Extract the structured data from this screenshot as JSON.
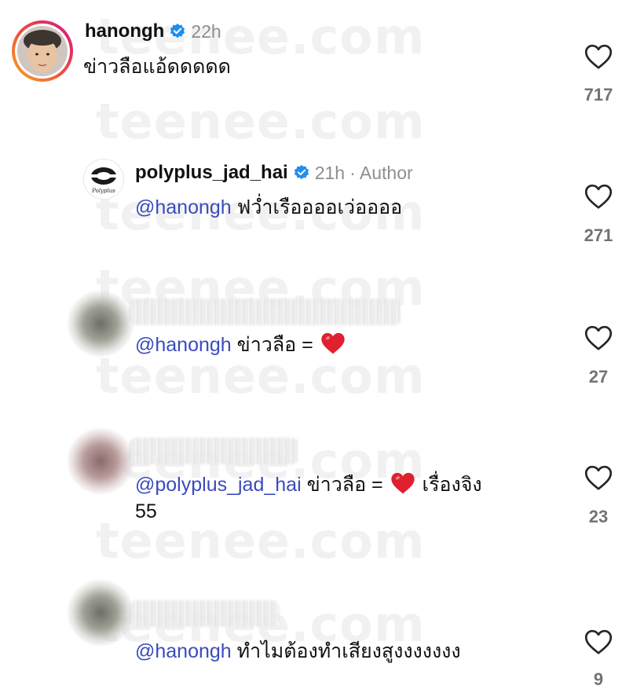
{
  "watermark": "teenee.com",
  "comments": [
    {
      "username": "hanongh",
      "time": "22h",
      "text": "ข่าวลือแอ้ดดดดด",
      "likes": "717"
    },
    {
      "username": "polyplus_jad_hai",
      "time": "21h",
      "author_label": "· Author",
      "mention": "@hanongh",
      "text": "ฟว่ำเรืออออเว่ออออ",
      "likes": "271"
    },
    {
      "mention": "@hanongh",
      "text": "ข่าวลือ =",
      "likes": "27"
    },
    {
      "mention": "@polyplus_jad_hai",
      "text": "ข่าวลือ =",
      "text_after": "เรื่องจิง",
      "text_line2": "55",
      "likes": "23"
    },
    {
      "mention": "@hanongh",
      "text": "ทำไมต้องทำเสียงสูงงงงงงง",
      "likes": "9"
    }
  ],
  "colors": {
    "mention": "#3a4bbd",
    "verified": "#1f8ef1",
    "heart_emoji": "#e0202f",
    "story_ring_start": "#f9a825",
    "story_ring_end": "#d5138a"
  },
  "icons": {
    "like": "heart-outline-icon",
    "verified": "verified-badge-icon",
    "emoji": "red-heart-emoji"
  }
}
